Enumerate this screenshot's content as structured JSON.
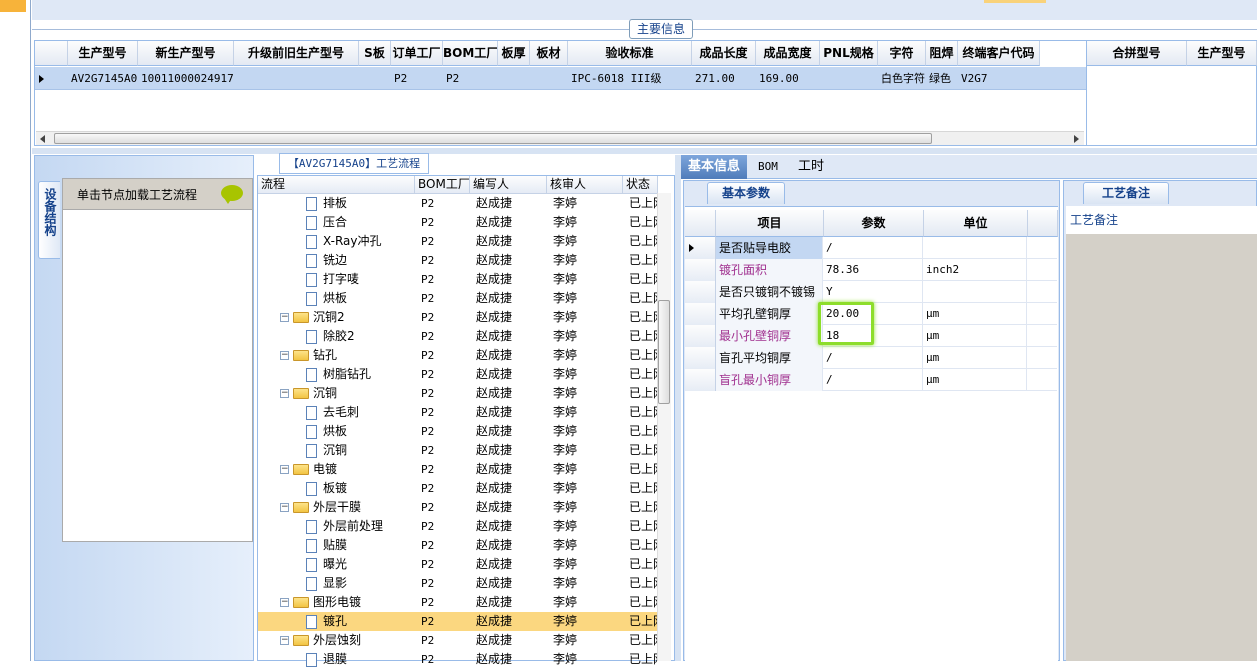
{
  "group_title": "主要信息",
  "main_grid": {
    "columns": [
      "生产型号",
      "新生产型号",
      "升级前旧生产型号",
      "S板",
      "订单工厂",
      "BOM工厂",
      "板厚",
      "板材",
      "验收标准",
      "成品长度",
      "成品宽度",
      "PNL规格",
      "字符",
      "阻焊",
      "终端客户代码"
    ],
    "row": {
      "生产型号": "AV2G7145A0",
      "新生产型号": "10011000024917",
      "升级前旧生产型号": "",
      "S板": "",
      "订单工厂": "P2",
      "BOM工厂": "P2",
      "板厚": "",
      "板材": "",
      "验收标准": "IPC-6018 III级",
      "成品长度": "271.00",
      "成品宽度": "169.00",
      "PNL规格": "",
      "字符": "白色字符",
      "阻焊": "绿色",
      "终端客户代码": "V2G7"
    }
  },
  "side_grid": {
    "columns": [
      "合拼型号",
      "生产型号"
    ]
  },
  "left_panel": {
    "vertical_tab": "设备结构",
    "header": "单击节点加载工艺流程"
  },
  "process_title": "【AV2G7145A0】工艺流程",
  "tree": {
    "columns": [
      "流程",
      "BOM工厂",
      "编写人",
      "核审人",
      "状态"
    ],
    "rows": [
      {
        "level": 2,
        "type": "doc",
        "name": "排板",
        "bom": "P2",
        "author": "赵成捷",
        "reviewer": "李婷",
        "status": "已上网"
      },
      {
        "level": 2,
        "type": "doc",
        "name": "压合",
        "bom": "P2",
        "author": "赵成捷",
        "reviewer": "李婷",
        "status": "已上网"
      },
      {
        "level": 2,
        "type": "doc",
        "name": "X-Ray冲孔",
        "bom": "P2",
        "author": "赵成捷",
        "reviewer": "李婷",
        "status": "已上网"
      },
      {
        "level": 2,
        "type": "doc",
        "name": "铣边",
        "bom": "P2",
        "author": "赵成捷",
        "reviewer": "李婷",
        "status": "已上网"
      },
      {
        "level": 2,
        "type": "doc",
        "name": "打字唛",
        "bom": "P2",
        "author": "赵成捷",
        "reviewer": "李婷",
        "status": "已上网"
      },
      {
        "level": 2,
        "type": "doc",
        "name": "烘板",
        "bom": "P2",
        "author": "赵成捷",
        "reviewer": "李婷",
        "status": "已上网"
      },
      {
        "level": 1,
        "type": "folder",
        "name": "沉铜2",
        "bom": "P2",
        "author": "赵成捷",
        "reviewer": "李婷",
        "status": "已上网"
      },
      {
        "level": 2,
        "type": "doc",
        "name": "除胶2",
        "bom": "P2",
        "author": "赵成捷",
        "reviewer": "李婷",
        "status": "已上网"
      },
      {
        "level": 1,
        "type": "folder",
        "name": "钻孔",
        "bom": "P2",
        "author": "赵成捷",
        "reviewer": "李婷",
        "status": "已上网"
      },
      {
        "level": 2,
        "type": "doc",
        "name": "树脂钻孔",
        "bom": "P2",
        "author": "赵成捷",
        "reviewer": "李婷",
        "status": "已上网"
      },
      {
        "level": 1,
        "type": "folder",
        "name": "沉铜",
        "bom": "P2",
        "author": "赵成捷",
        "reviewer": "李婷",
        "status": "已上网"
      },
      {
        "level": 2,
        "type": "doc",
        "name": "去毛刺",
        "bom": "P2",
        "author": "赵成捷",
        "reviewer": "李婷",
        "status": "已上网"
      },
      {
        "level": 2,
        "type": "doc",
        "name": "烘板",
        "bom": "P2",
        "author": "赵成捷",
        "reviewer": "李婷",
        "status": "已上网"
      },
      {
        "level": 2,
        "type": "doc",
        "name": "沉铜",
        "bom": "P2",
        "author": "赵成捷",
        "reviewer": "李婷",
        "status": "已上网"
      },
      {
        "level": 1,
        "type": "folder",
        "name": "电镀",
        "bom": "P2",
        "author": "赵成捷",
        "reviewer": "李婷",
        "status": "已上网"
      },
      {
        "level": 2,
        "type": "doc",
        "name": "板镀",
        "bom": "P2",
        "author": "赵成捷",
        "reviewer": "李婷",
        "status": "已上网"
      },
      {
        "level": 1,
        "type": "folder",
        "name": "外层干膜",
        "bom": "P2",
        "author": "赵成捷",
        "reviewer": "李婷",
        "status": "已上网"
      },
      {
        "level": 2,
        "type": "doc",
        "name": "外层前处理",
        "bom": "P2",
        "author": "赵成捷",
        "reviewer": "李婷",
        "status": "已上网"
      },
      {
        "level": 2,
        "type": "doc",
        "name": "贴膜",
        "bom": "P2",
        "author": "赵成捷",
        "reviewer": "李婷",
        "status": "已上网"
      },
      {
        "level": 2,
        "type": "doc",
        "name": "曝光",
        "bom": "P2",
        "author": "赵成捷",
        "reviewer": "李婷",
        "status": "已上网"
      },
      {
        "level": 2,
        "type": "doc",
        "name": "显影",
        "bom": "P2",
        "author": "赵成捷",
        "reviewer": "李婷",
        "status": "已上网"
      },
      {
        "level": 1,
        "type": "folder",
        "name": "图形电镀",
        "bom": "P2",
        "author": "赵成捷",
        "reviewer": "李婷",
        "status": "已上网"
      },
      {
        "level": 2,
        "type": "doc",
        "name": "镀孔",
        "bom": "P2",
        "author": "赵成捷",
        "reviewer": "李婷",
        "status": "已上网",
        "selected": true
      },
      {
        "level": 1,
        "type": "folder",
        "name": "外层蚀刻",
        "bom": "P2",
        "author": "赵成捷",
        "reviewer": "李婷",
        "status": "已上网"
      },
      {
        "level": 2,
        "type": "doc",
        "name": "退膜",
        "bom": "P2",
        "author": "赵成捷",
        "reviewer": "李婷",
        "status": "已上网"
      }
    ]
  },
  "tabs": [
    "基本信息",
    "BOM",
    "工时"
  ],
  "active_tab": "基本信息",
  "basic_params": {
    "tab_label": "基本参数",
    "columns": [
      "项目",
      "参数",
      "单位"
    ],
    "rows": [
      {
        "item": "是否贴导电胶",
        "value": "/",
        "unit": "",
        "color": "#000000"
      },
      {
        "item": "镀孔面积",
        "value": "78.36",
        "unit": "inch2",
        "color": "#a0308f"
      },
      {
        "item": "是否只镀铜不镀锡",
        "value": "Y",
        "unit": "",
        "color": "#000000"
      },
      {
        "item": "平均孔壁铜厚",
        "value": "20.00",
        "unit": "μm",
        "color": "#000000"
      },
      {
        "item": "最小孔壁铜厚",
        "value": "18",
        "unit": "μm",
        "color": "#a0308f"
      },
      {
        "item": "盲孔平均铜厚",
        "value": "/",
        "unit": "μm",
        "color": "#000000"
      },
      {
        "item": "盲孔最小铜厚",
        "value": "/",
        "unit": "μm",
        "color": "#a0308f"
      }
    ]
  },
  "notes": {
    "tab_label": "工艺备注",
    "field_label": "工艺备注"
  },
  "colors": {
    "accent": "#15428b",
    "highlight": "#8ddd2b",
    "selected_row": "#fbd780"
  }
}
